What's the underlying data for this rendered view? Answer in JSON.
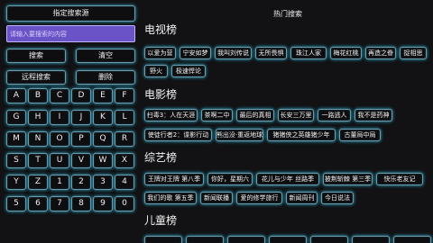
{
  "left_panel": {
    "source_button": "指定搜索源",
    "search_placeholder": "请输入要搜索的内容",
    "search_button": "搜索",
    "clear_button": "清空",
    "remote_search_button": "远程搜索",
    "delete_button": "删除",
    "keys": [
      "A",
      "B",
      "C",
      "D",
      "E",
      "F",
      "G",
      "H",
      "I",
      "J",
      "K",
      "L",
      "M",
      "N",
      "O",
      "P",
      "Q",
      "R",
      "S",
      "T",
      "U",
      "V",
      "W",
      "X",
      "Y",
      "Z",
      "1",
      "2",
      "3",
      "4",
      "5",
      "6",
      "7",
      "8",
      "9",
      "0"
    ]
  },
  "right_panel": {
    "title": "热门搜索",
    "categories": [
      {
        "title": "电视榜",
        "rows": [
          [
            "以爱为营",
            "宁安如梦",
            "我叫刘传说",
            "无所畏惧",
            "珠江人家",
            "梅花红桃",
            "再造之眷",
            "捉相思"
          ],
          [
            "野火",
            "极速悍论"
          ]
        ]
      },
      {
        "title": "电影榜",
        "rows": [
          [
            "扫毒3：人在天涯",
            "茶啊二中",
            "最后的真相",
            "长安三万里",
            "一路逃人",
            "我不是药神"
          ],
          [
            "使徒行者2：谍影行动",
            "熊出没·重返地球",
            "猪猪侠之英雄猪少年",
            "古董局中局"
          ]
        ]
      },
      {
        "title": "综艺榜",
        "rows": [
          [
            "王牌对王牌 第八季",
            "你好，星期六",
            "花儿与少年 丝路季",
            "披荆斩棘 第三季",
            "快乐老友记"
          ],
          [
            "我们的歌 第五季",
            "新闻联播",
            "爱的修学旅行",
            "新闻周刊",
            "今日说法"
          ]
        ]
      },
      {
        "title": "儿童榜",
        "rows": []
      }
    ]
  }
}
